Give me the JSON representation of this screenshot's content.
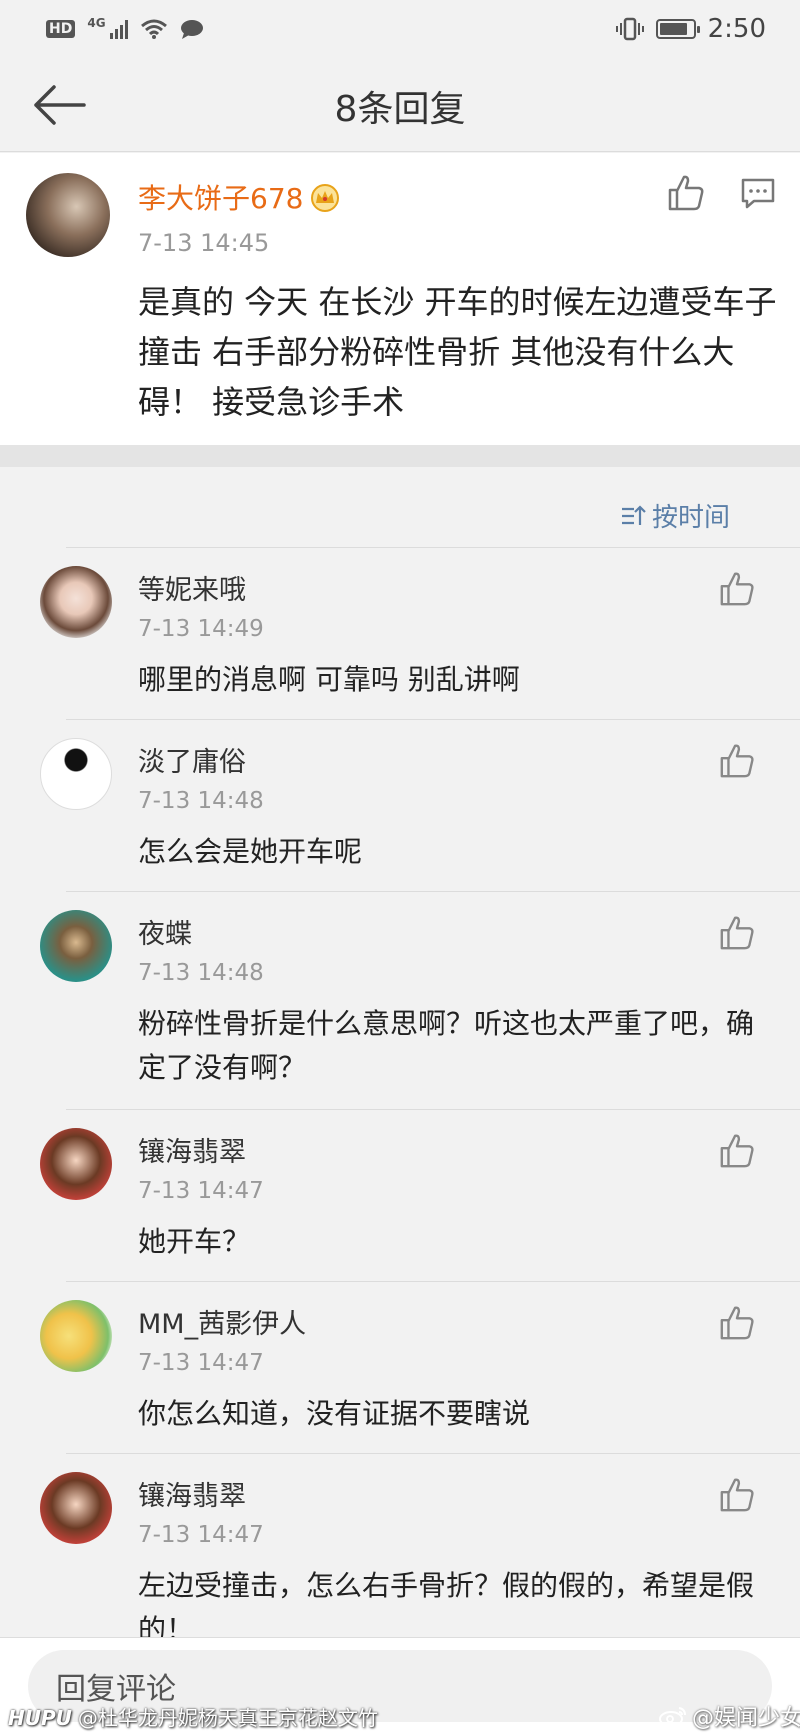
{
  "status_bar": {
    "hd": "HD",
    "network": "4G",
    "time": "2:50",
    "battery_level": 0.85
  },
  "header": {
    "title": "8条回复"
  },
  "main_post": {
    "author": "李大饼子678",
    "time": "7-13 14:45",
    "text": "是真的 今天 在长沙 开车的时候左边遭受车子撞击 右手部分粉碎性骨折 其他没有什么大碍！ 接受急诊手术",
    "author_color": "#e86b16"
  },
  "sort": {
    "label": "按时间",
    "color": "#5b7fa8"
  },
  "replies": [
    {
      "name": "等妮来哦",
      "time": "7-13 14:49",
      "text": " 哪里的消息啊 可靠吗 别乱讲啊"
    },
    {
      "name": "淡了庸俗",
      "time": "7-13 14:48",
      "text": "怎么会是她开车呢"
    },
    {
      "name": "夜蝶",
      "time": "7-13 14:48",
      "text": "粉碎性骨折是什么意思啊？听这也太严重了吧，确定了没有啊？"
    },
    {
      "name": "镶海翡翠",
      "time": "7-13 14:47",
      "text": "她开车？"
    },
    {
      "name": "MM_茜影伊人",
      "time": "7-13 14:47",
      "text": "你怎么知道，没有证据不要瞎说"
    },
    {
      "name": "镶海翡翠",
      "time": "7-13 14:47",
      "text": "左边受撞击，怎么右手骨折？假的假的，希望是假的！"
    }
  ],
  "bottom_bar": {
    "placeholder": "回复评论"
  },
  "watermarks": {
    "left_brand": "HUPU",
    "left_text": "@杜华龙丹妮杨天真王京花赵文竹",
    "right_text": "@娱闻少女"
  }
}
